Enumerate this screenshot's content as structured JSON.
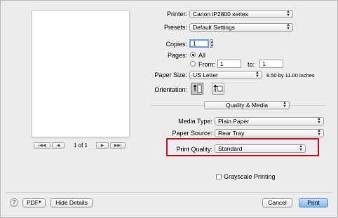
{
  "preview": {
    "page_counter": "1 of 1",
    "first_icon": "|◀◀",
    "prev_icon": "◀",
    "next_icon": "▶",
    "last_icon": "▶▶|"
  },
  "printer": {
    "label": "Printer:",
    "value": "Canon iP2800 series"
  },
  "presets": {
    "label": "Presets:",
    "value": "Default Settings"
  },
  "copies": {
    "label": "Copies:",
    "value": "1"
  },
  "pages": {
    "label": "Pages:",
    "all_label": "All",
    "from_label": "From:",
    "from_value": "1",
    "to_label": "to:",
    "to_value": "1"
  },
  "paper_size": {
    "label": "Paper Size:",
    "value": "US Letter",
    "dimensions": "8.50 by 11.00 inches"
  },
  "orientation": {
    "label": "Orientation:"
  },
  "section": {
    "value": "Quality & Media"
  },
  "media_type": {
    "label": "Media Type:",
    "value": "Plain Paper"
  },
  "paper_source": {
    "label": "Paper Source:",
    "value": "Rear Tray"
  },
  "print_quality": {
    "label": "Print Quality:",
    "value": "Standard"
  },
  "grayscale": {
    "label": "Grayscale Printing",
    "checked": false
  },
  "footer": {
    "help": "?",
    "pdf_label": "PDF",
    "hide_details_label": "Hide Details",
    "cancel_label": "Cancel",
    "print_label": "Print"
  },
  "colors": {
    "highlight": "#e0101a",
    "default_button": "#7fb4ef"
  }
}
